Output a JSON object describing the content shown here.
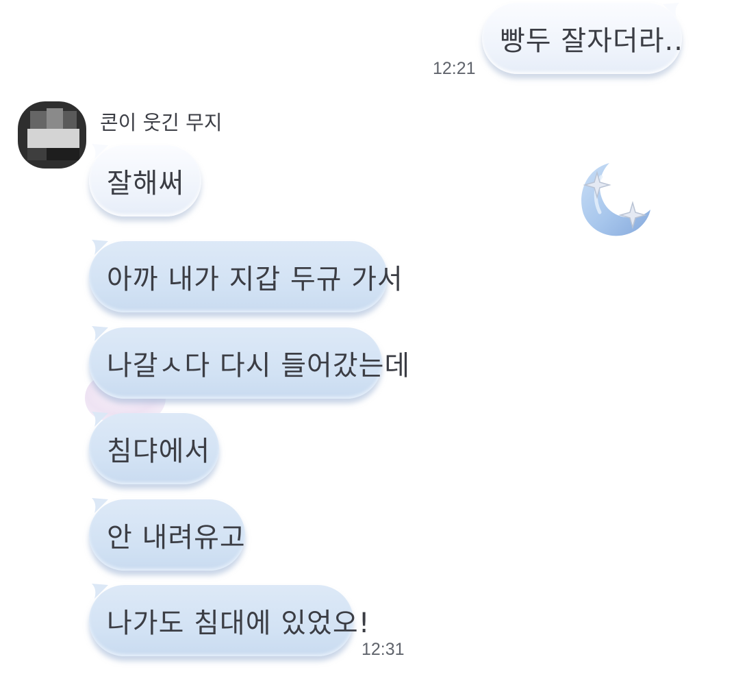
{
  "chat": {
    "outgoing": {
      "text": "빵두 잘자더라..",
      "time": "12:21"
    },
    "sender": {
      "name": "콘이 웃긴 무지"
    },
    "incoming": [
      {
        "text": "잘해써"
      },
      {
        "text": "아까 내가 지갑 두규 가서"
      },
      {
        "text": "나갈ㅅ다 다시 들어갔는데"
      },
      {
        "text": "침댜에서"
      },
      {
        "text": "안 내려유고"
      },
      {
        "text": "나가도 침대에 있었오!"
      }
    ],
    "last_time": "12:31"
  },
  "colors": {
    "bubble_light": "#f6f8fd",
    "bubble_blue": "#d6e4f5",
    "text": "#3b3d44",
    "time": "#5f636b"
  },
  "icons": {
    "moon_sticker": "moon-with-stars-icon",
    "avatar": "blurred-profile-avatar"
  }
}
